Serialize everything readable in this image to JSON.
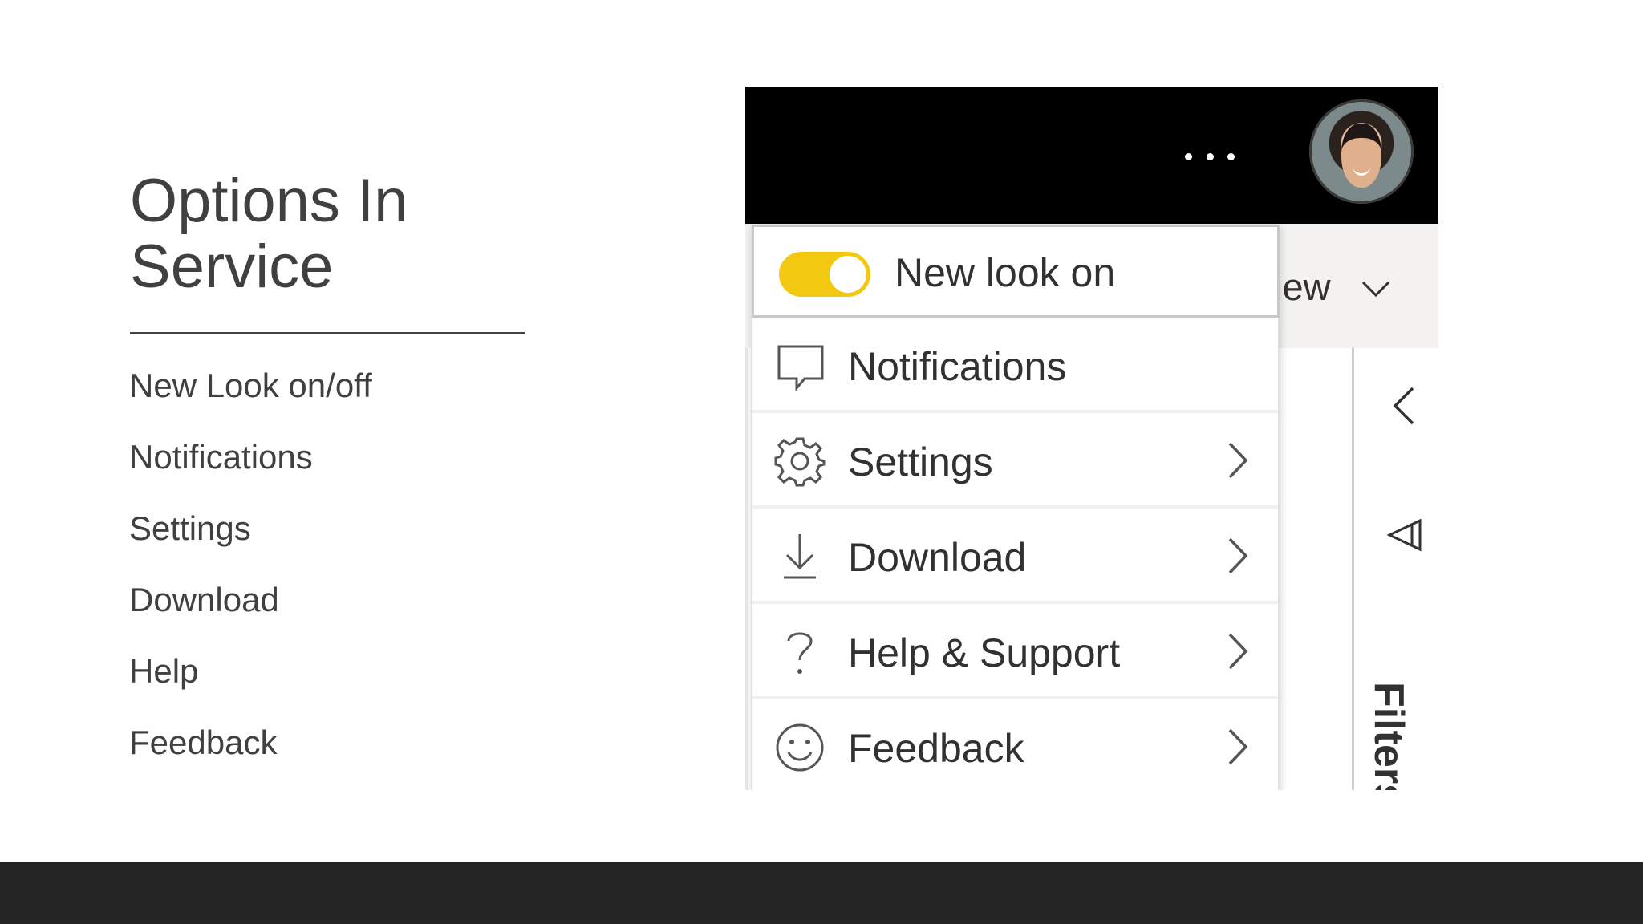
{
  "slide": {
    "title_line1": "Options In",
    "title_line2": "Service",
    "bullets": [
      "New Look on/off",
      "Notifications",
      "Settings",
      "Download",
      "Help",
      "Feedback"
    ]
  },
  "screenshot": {
    "header": {
      "more_icon": "more-options-icon",
      "avatar_icon": "user-avatar"
    },
    "view_text": "iew",
    "filters_label": "Filters",
    "menu": {
      "toggle": {
        "label": "New look on",
        "state": "on",
        "color": "#f2c811"
      },
      "items": [
        {
          "label": "Notifications",
          "icon": "chat-bubble-icon",
          "has_submenu": false
        },
        {
          "label": "Settings",
          "icon": "gear-icon",
          "has_submenu": true
        },
        {
          "label": "Download",
          "icon": "download-icon",
          "has_submenu": true
        },
        {
          "label": "Help & Support",
          "icon": "question-mark-icon",
          "has_submenu": true
        },
        {
          "label": "Feedback",
          "icon": "smiley-icon",
          "has_submenu": true
        }
      ]
    }
  },
  "colors": {
    "text": "#404040",
    "footer": "#252526",
    "header": "#000000",
    "toggle": "#f2c811"
  }
}
